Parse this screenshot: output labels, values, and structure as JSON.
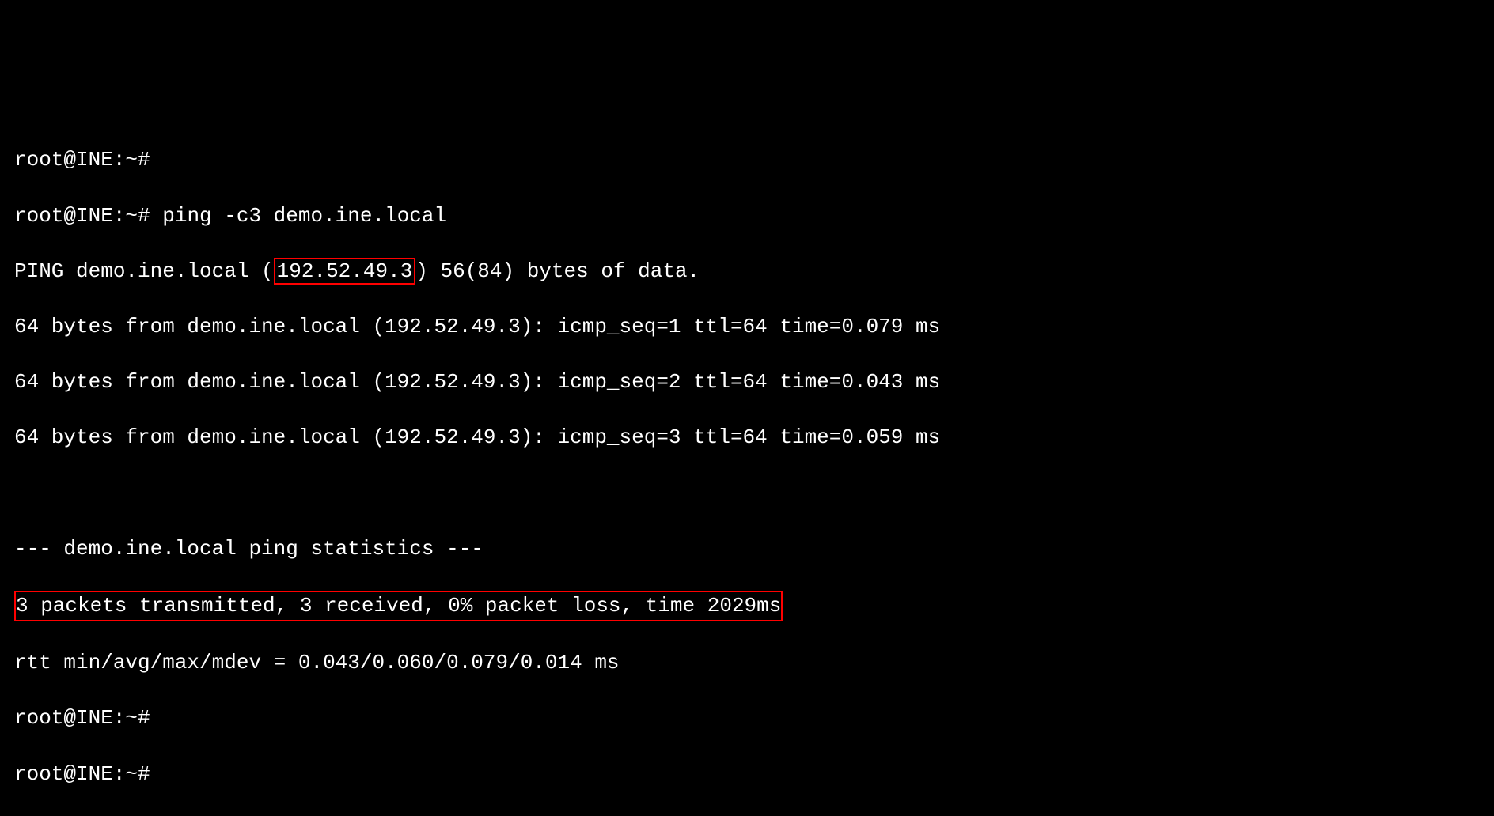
{
  "terminal": {
    "prompt": "root@INE:~#",
    "command": "ping -c3 demo.ine.local",
    "ping_header_pre": "PING demo.ine.local (",
    "ping_ip": "192.52.49.3",
    "ping_header_post": ") 56(84) bytes of data.",
    "reply1": "64 bytes from demo.ine.local (192.52.49.3): icmp_seq=1 ttl=64 time=0.079 ms",
    "reply2": "64 bytes from demo.ine.local (192.52.49.3): icmp_seq=2 ttl=64 time=0.043 ms",
    "reply3": "64 bytes from demo.ine.local (192.52.49.3): icmp_seq=3 ttl=64 time=0.059 ms",
    "stats_header": "--- demo.ine.local ping statistics ---",
    "stats_line": "3 packets transmitted, 3 received, 0% packet loss, time 2029ms",
    "rtt_line": "rtt min/avg/max/mdev = 0.043/0.060/0.079/0.014 ms"
  }
}
